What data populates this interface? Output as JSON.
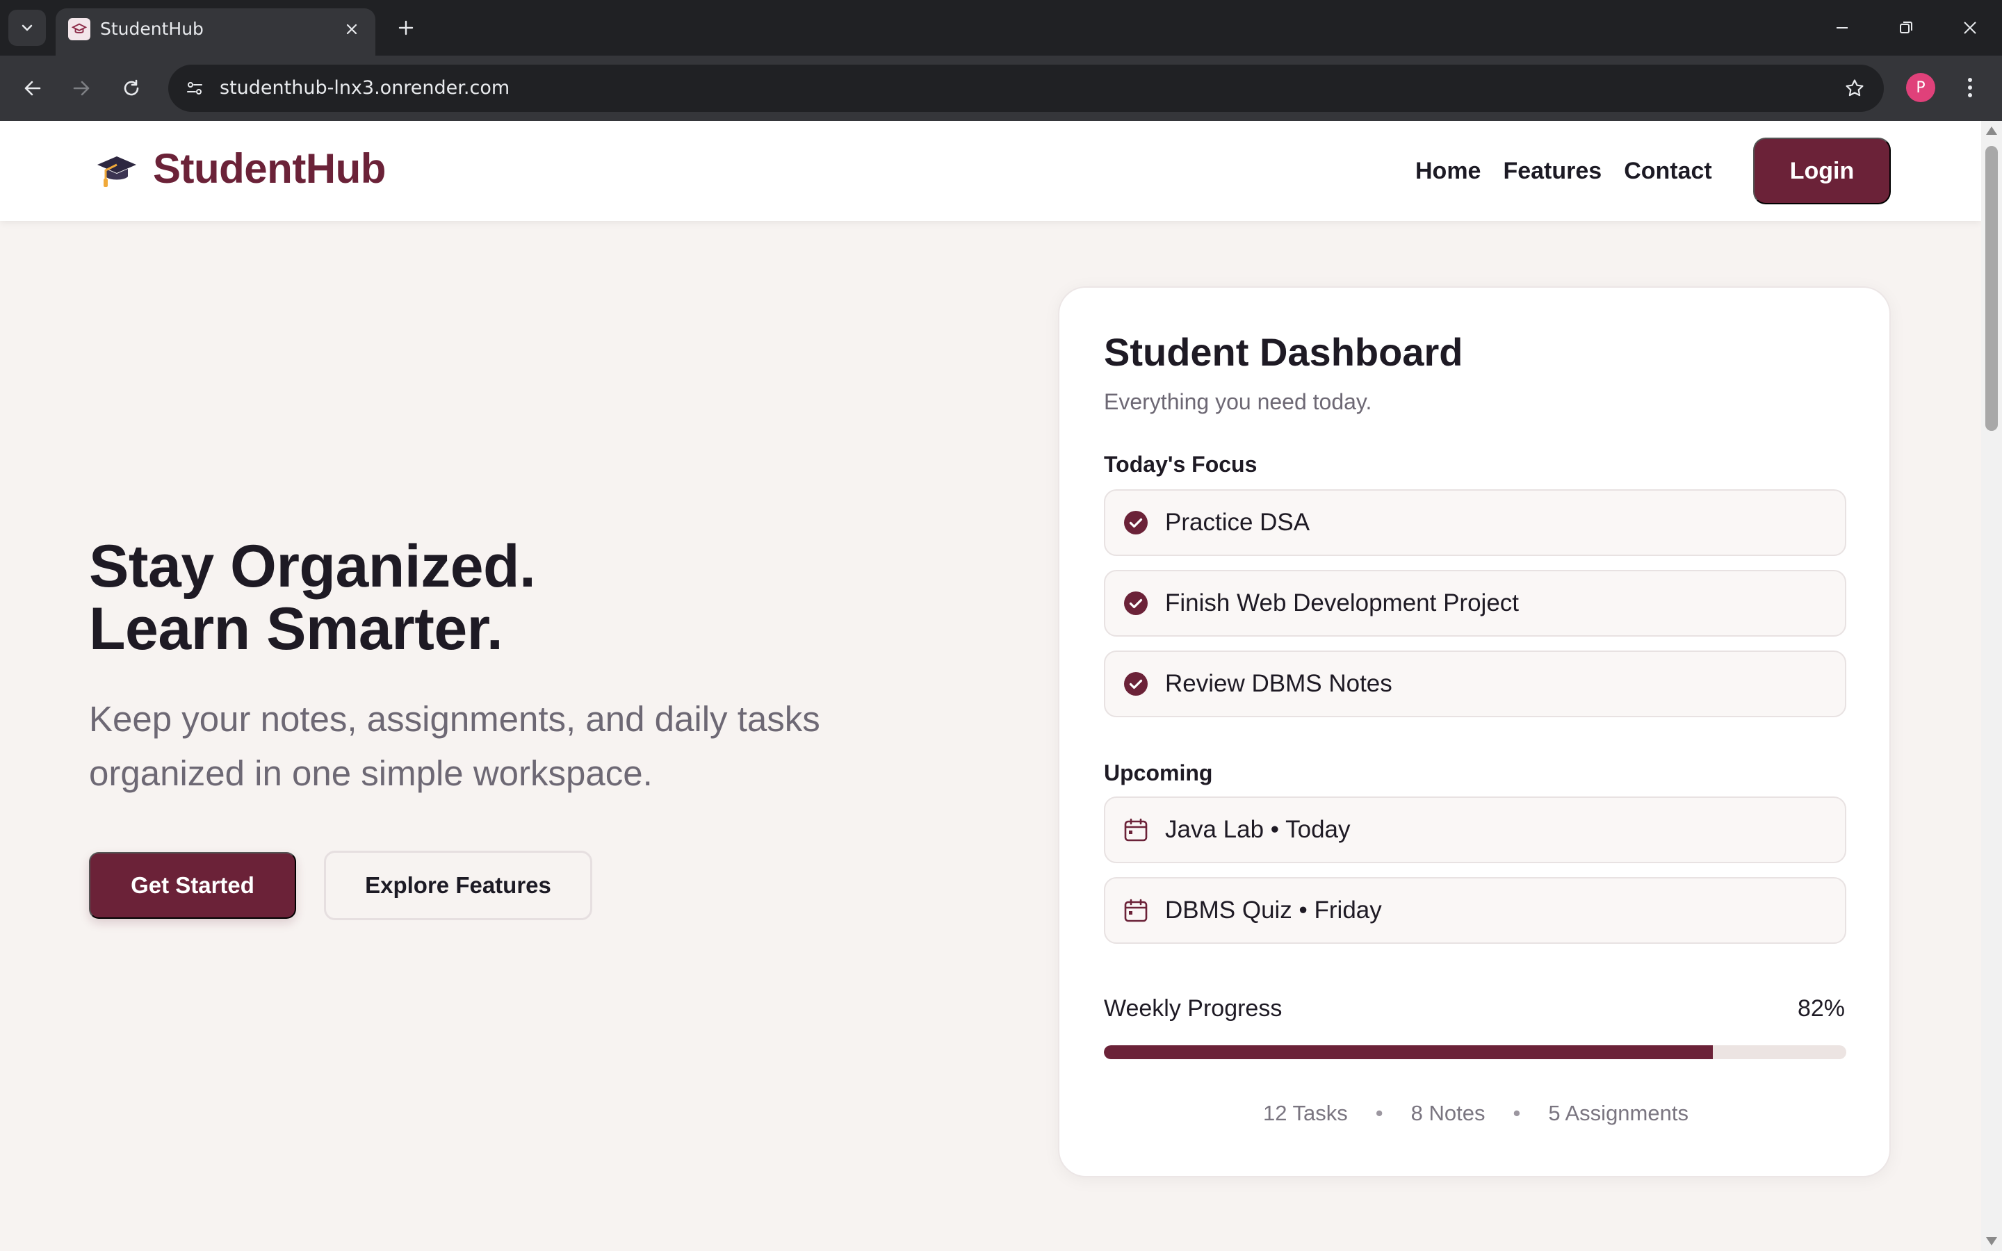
{
  "browser": {
    "tab_title": "StudentHub",
    "url": "studenthub-lnx3.onrender.com",
    "profile_initial": "P"
  },
  "header": {
    "brand": "StudentHub",
    "nav": [
      "Home",
      "Features",
      "Contact"
    ],
    "login_label": "Login"
  },
  "hero": {
    "title_line1": "Stay Organized.",
    "title_line2": "Learn Smarter.",
    "subtitle": "Keep your notes, assignments, and daily tasks organized in one simple workspace.",
    "primary_cta": "Get Started",
    "secondary_cta": "Explore Features"
  },
  "dashboard": {
    "title": "Student Dashboard",
    "subtitle": "Everything you need today.",
    "focus_label": "Today's Focus",
    "focus_items": [
      "Practice DSA",
      "Finish Web Development Project",
      "Review DBMS Notes"
    ],
    "upcoming_label": "Upcoming",
    "upcoming_items": [
      "Java Lab • Today",
      "DBMS Quiz • Friday"
    ],
    "progress_label": "Weekly Progress",
    "progress_text": "82%",
    "progress_fraction": 0.82,
    "stats": [
      "12 Tasks",
      "8 Notes",
      "5 Assignments"
    ],
    "stat_separator": "•"
  },
  "colors": {
    "brand": "#6b2238",
    "page_bg": "#f7f3f1",
    "text_dark": "#1e1a24",
    "text_muted": "#6d6874"
  },
  "icons": {
    "focus_item": "check-circle-icon",
    "upcoming_item": "calendar-icon",
    "logo": "graduation-cap-icon"
  }
}
